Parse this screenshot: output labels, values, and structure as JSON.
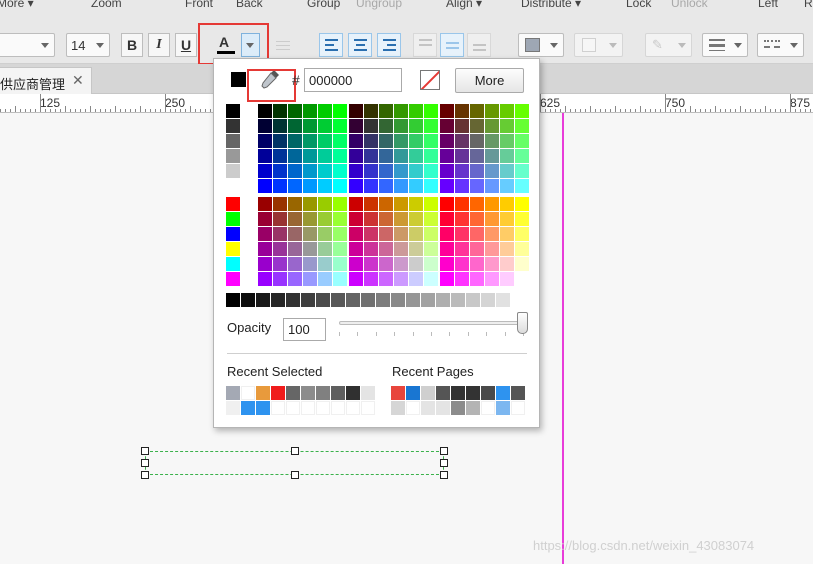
{
  "menubar": {
    "more": "More ▾",
    "zoom": "Zoom",
    "front": "Front",
    "back": "Back",
    "group": "Group",
    "ungroup": "Ungroup",
    "align": "Align ▾",
    "distribute": "Distribute ▾",
    "lock": "Lock",
    "unlock": "Unlock",
    "left": "Left",
    "right_partial": "R"
  },
  "toolbar": {
    "font_size": "14",
    "bold": "B",
    "italic": "I",
    "underline": "U",
    "font_color_glyph": "A",
    "font_color_value": "#000000"
  },
  "tab": {
    "label": "供应商管理",
    "close": "✕"
  },
  "ruler": {
    "labels": [
      "125",
      "250",
      "625",
      "750",
      "875"
    ]
  },
  "picker": {
    "current_color": "#000000",
    "hash": "#",
    "hex_value": "000000",
    "more_label": "More",
    "opacity_label": "Opacity",
    "opacity_value": "100",
    "opacity_fraction": 1.0,
    "recent_selected_label": "Recent Selected",
    "recent_pages_label": "Recent Pages",
    "recent_selected": [
      "#a4a9b4",
      "#ffffff",
      "#e89a3c",
      "#f01c1c",
      "#666666",
      "#8c8c8c",
      "#808080",
      "#5f5f5f",
      "#303030",
      "#e4e4e4",
      "#f0f0f0",
      "#2e93ef",
      "#2e93ef",
      "#ffffff",
      "#ffffff",
      "#ffffff",
      "#ffffff",
      "#ffffff",
      "#ffffff",
      "#ffffff"
    ],
    "recent_pages": [
      "#e8453c",
      "#1976d2",
      "#cfcfcf",
      "#555555",
      "#333333",
      "#333333",
      "#4a4a4a",
      "#2e93ef",
      "#555555",
      "#d6d6d6",
      "#ffffff",
      "#e4e4e4",
      "#e4e4e4",
      "#8c8c8c",
      "#b4b4b4",
      "#ffffff",
      "#7cb7f0",
      "#ffffff"
    ]
  },
  "watermark": "https://blog.csdn.net/weixin_43083074"
}
